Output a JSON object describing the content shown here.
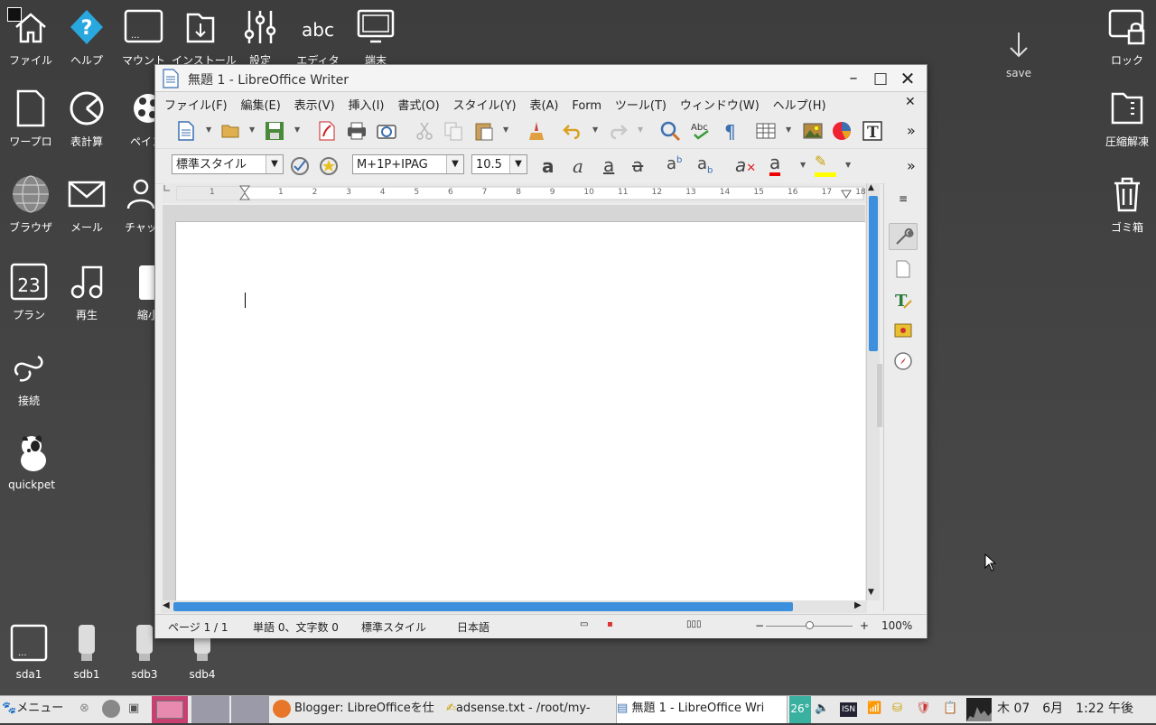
{
  "desktop": {
    "icons": [
      {
        "label": "ファイル",
        "icon": "home-icon"
      },
      {
        "label": "ヘルプ",
        "icon": "help-icon"
      },
      {
        "label": "マウント",
        "icon": "drive-icon"
      },
      {
        "label": "インストール",
        "icon": "install-icon"
      },
      {
        "label": "設定",
        "icon": "settings-icon"
      },
      {
        "label": "エディタ",
        "icon": "editor-icon"
      },
      {
        "label": "端末",
        "icon": "terminal-icon"
      },
      {
        "label": "ワープロ",
        "icon": "document-icon"
      },
      {
        "label": "表計算",
        "icon": "spreadsheet-icon"
      },
      {
        "label": "ペイン",
        "icon": "paint-icon"
      },
      {
        "label": "ブラウザ",
        "icon": "globe-icon"
      },
      {
        "label": "メール",
        "icon": "mail-icon"
      },
      {
        "label": "チャッ",
        "icon": "chat-icon"
      },
      {
        "label": "プラン",
        "icon": "calendar-icon"
      },
      {
        "label": "再生",
        "icon": "music-icon"
      },
      {
        "label": "縮小",
        "icon": "shrink-icon"
      },
      {
        "label": "接続",
        "icon": "connect-icon"
      },
      {
        "label": "quickpet",
        "icon": "dog-icon"
      },
      {
        "label": "save",
        "icon": "save-arrow-icon"
      },
      {
        "label": "ロック",
        "icon": "lock-icon"
      },
      {
        "label": "圧縮解凍",
        "icon": "archive-icon"
      },
      {
        "label": "ゴミ箱",
        "icon": "trash-icon"
      },
      {
        "label": "sda1",
        "icon": "disk-icon"
      },
      {
        "label": "sdb1",
        "icon": "usb-icon"
      },
      {
        "label": "sdb3",
        "icon": "usb-icon"
      },
      {
        "label": "sdb4",
        "icon": "usb-icon"
      },
      {
        "label": "23",
        "icon": "calendar-day"
      }
    ]
  },
  "window": {
    "title": "無題 1 - LibreOffice Writer",
    "menu": [
      "ファイル(F)",
      "編集(E)",
      "表示(V)",
      "挿入(I)",
      "書式(O)",
      "スタイル(Y)",
      "表(A)",
      "Form",
      "ツール(T)",
      "ウィンドウ(W)",
      "ヘルプ(H)"
    ],
    "toolbar2": {
      "paragraph_style": "標準スタイル",
      "font_name": "M+1P+IPAG",
      "font_size": "10.5"
    },
    "ruler_numbers": [
      "1",
      "1",
      "2",
      "3",
      "4",
      "5",
      "6",
      "7",
      "8",
      "9",
      "10",
      "11",
      "12",
      "13",
      "14",
      "15",
      "16",
      "17",
      "18"
    ],
    "status": {
      "page": "ページ 1 / 1",
      "words": "単語 0、文字数 0",
      "style": "標準スタイル",
      "language": "日本語",
      "zoom": "100%"
    },
    "overflow": "»"
  },
  "taskbar": {
    "menu_label": "メニュー",
    "tasks": [
      "Blogger: LibreOfficeを仕",
      "adsense.txt - /root/my-",
      "無題 1 - LibreOffice Wri"
    ],
    "temperature": "26°",
    "clock": "木 07　6月　1:22 午後",
    "colors": {
      "pink": "#e88ab0"
    }
  }
}
